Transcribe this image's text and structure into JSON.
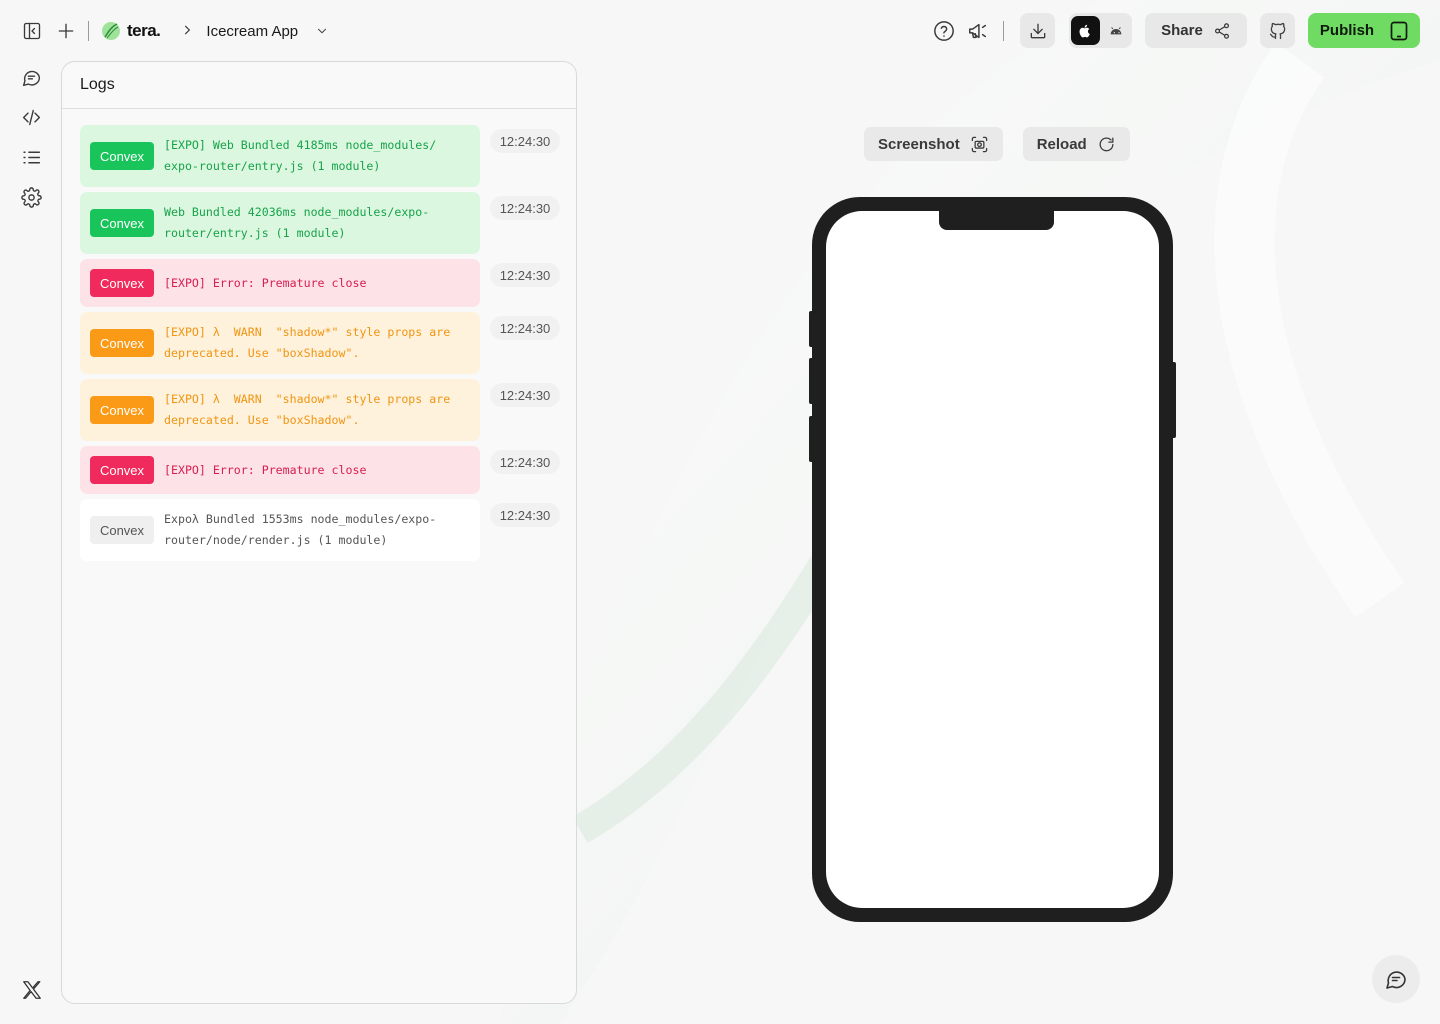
{
  "header": {
    "brand_name": "tera.",
    "project_name": "Icecream App",
    "share_label": "Share",
    "publish_label": "Publish"
  },
  "icons": {
    "rail": [
      "sidebar-toggle-icon",
      "plus-icon",
      "chat-icon",
      "code-icon",
      "list-icon",
      "settings-icon",
      "x-logo-icon"
    ],
    "top_right": [
      "help-icon",
      "megaphone-icon",
      "download-icon",
      "apple-icon",
      "android-icon",
      "share-icon",
      "github-icon",
      "tablet-icon"
    ]
  },
  "logs": {
    "title": "Logs",
    "entries": [
      {
        "level": "success",
        "source": "Convex",
        "message": "[EXPO] Web Bundled 4185ms node_modules/\nexpo-router/entry.js (1 module)",
        "time": "12:24:30"
      },
      {
        "level": "success",
        "source": "Convex",
        "message": "Web Bundled 42036ms node_modules/expo-\nrouter/entry.js (1 module)",
        "time": "12:24:30"
      },
      {
        "level": "error",
        "source": "Convex",
        "message": "[EXPO] Error: Premature close",
        "time": "12:24:30"
      },
      {
        "level": "warn",
        "source": "Convex",
        "message": "[EXPO] λ  WARN  \"shadow*\" style props are\ndeprecated. Use \"boxShadow\".",
        "time": "12:24:30"
      },
      {
        "level": "warn",
        "source": "Convex",
        "message": "[EXPO] λ  WARN  \"shadow*\" style props are\ndeprecated. Use \"boxShadow\".",
        "time": "12:24:30"
      },
      {
        "level": "error",
        "source": "Convex",
        "message": "[EXPO] Error: Premature close",
        "time": "12:24:30"
      },
      {
        "level": "neutral",
        "source": "Convex",
        "message": "Expoλ Bundled 1553ms node_modules/expo-\nrouter/node/render.js (1 module)",
        "time": "12:24:30"
      }
    ]
  },
  "preview": {
    "screenshot_label": "Screenshot",
    "reload_label": "Reload",
    "platform_selected": "ios"
  },
  "colors": {
    "publish": "#6fdb62",
    "success": "#19c55a",
    "error": "#f02a5c",
    "warn": "#fa9a16",
    "phone_frame": "#1f1f1f"
  }
}
